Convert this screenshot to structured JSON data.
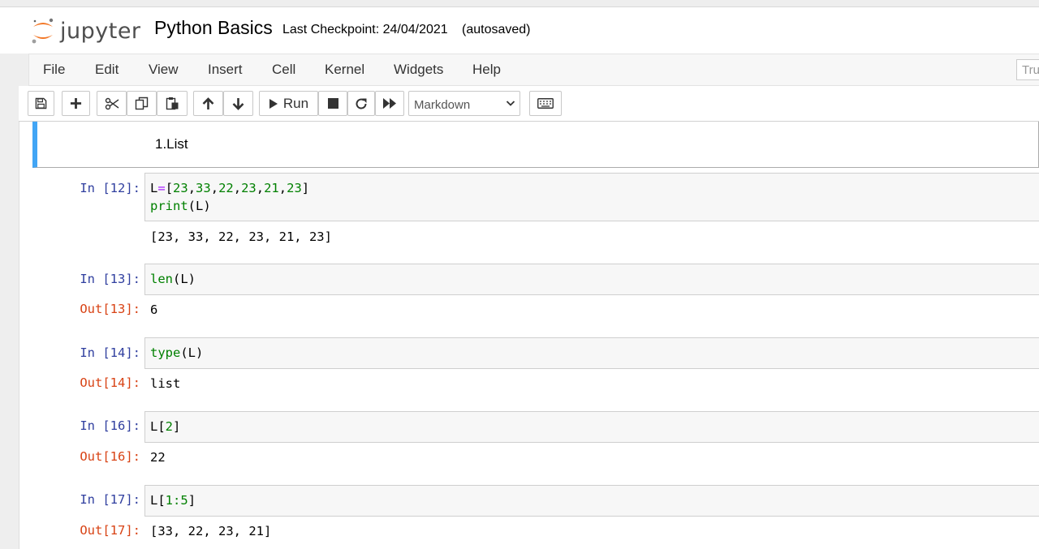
{
  "header": {
    "logo_text": "jupyter",
    "notebook_title": "Python Basics",
    "checkpoint": "Last Checkpoint: 24/04/2021",
    "autosave_status": "(autosaved)"
  },
  "menu": {
    "items": [
      "File",
      "Edit",
      "View",
      "Insert",
      "Cell",
      "Kernel",
      "Widgets",
      "Help"
    ],
    "trusted_label": "Trusted"
  },
  "toolbar": {
    "run_label": "Run",
    "cell_type": "Markdown",
    "icons": [
      "save-icon",
      "plus-icon",
      "scissors-icon",
      "copy-icon",
      "paste-icon",
      "arrow-up-icon",
      "arrow-down-icon",
      "play-icon",
      "stop-icon",
      "restart-icon",
      "fast-forward-icon",
      "keyboard-icon"
    ]
  },
  "cells": {
    "markdown": {
      "text": "1.List"
    },
    "c12": {
      "prompt": "In [12]:",
      "line1": {
        "var": "L",
        "op": "=",
        "open": "[",
        "n1": "23",
        "n2": "33",
        "n3": "22",
        "n4": "23",
        "n5": "21",
        "n6": "23",
        "comma": ",",
        "close": "]"
      },
      "line2": {
        "fn": "print",
        "args": "(L)"
      },
      "output": "[23, 33, 22, 23, 21, 23]"
    },
    "c13": {
      "prompt": "In [13]:",
      "fn": "len",
      "args": "(L)",
      "out_prompt": "Out[13]:",
      "output": "6"
    },
    "c14": {
      "prompt": "In [14]:",
      "fn": "type",
      "args": "(L)",
      "out_prompt": "Out[14]:",
      "output": "list"
    },
    "c16": {
      "prompt": "In [16]:",
      "pre": "L[",
      "num": "2",
      "post": "]",
      "out_prompt": "Out[16]:",
      "output": "22"
    },
    "c17": {
      "prompt": "In [17]:",
      "pre": "L[",
      "num": "1",
      "op": ":",
      "num2": "5",
      "post": "]",
      "out_prompt": "Out[17]:",
      "output": "[33, 22, 23, 21]"
    }
  },
  "colors": {
    "accent_blue": "#42a5f5",
    "prompt_in": "#303f9f",
    "prompt_out": "#d84315",
    "code_number": "#008000",
    "code_operator": "#aa22ff",
    "logo_orange": "#f37726"
  }
}
